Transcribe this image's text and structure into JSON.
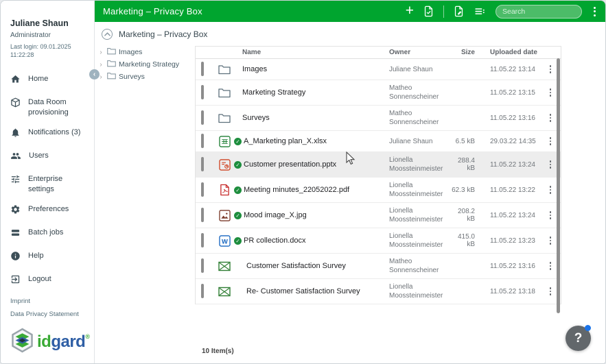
{
  "colors": {
    "brand_green": "#00a52f",
    "logo_green": "#3aaa35",
    "logo_blue": "#2f5fa5",
    "badge_green": "#1e8e3e",
    "row_highlight": "#ededed",
    "help_fab_gray": "#5a5f63",
    "notification_dot_blue": "#1a73e8"
  },
  "sidebar": {
    "user": {
      "name": "Juliane Shaun",
      "role": "Administrator",
      "last_login": "Last login: 09.01.2025 11:22:28"
    },
    "nav": [
      {
        "id": "home",
        "icon": "home-icon",
        "label": "Home"
      },
      {
        "id": "data-room-provisioning",
        "icon": "data-room-icon",
        "label": "Data Room provisioning"
      },
      {
        "id": "notifications",
        "icon": "bell-icon",
        "label": "Notifications (3)"
      },
      {
        "id": "users",
        "icon": "users-icon",
        "label": "Users"
      },
      {
        "id": "enterprise-settings",
        "icon": "sliders-icon",
        "label": "Enterprise settings"
      },
      {
        "id": "preferences",
        "icon": "gear-icon",
        "label": "Preferences"
      },
      {
        "id": "batch-jobs",
        "icon": "batch-icon",
        "label": "Batch jobs"
      },
      {
        "id": "help",
        "icon": "info-icon",
        "label": "Help"
      },
      {
        "id": "logout",
        "icon": "logout-icon",
        "label": "Logout"
      }
    ],
    "links": [
      "Imprint",
      "Data Privacy Statement"
    ],
    "logo": {
      "text_part1": "id",
      "text_part2": "gard",
      "reg_mark": "®"
    }
  },
  "header": {
    "title": "Marketing – Privacy Box",
    "search_placeholder": "Search",
    "action_icons": [
      "add-icon",
      "file-check-icon",
      "file-edit-icon",
      "list-options-icon",
      "more-icon"
    ]
  },
  "breadcrumb": {
    "label": "Marketing – Privacy Box",
    "icon": "chevron-up-circle-icon"
  },
  "tree": {
    "items": [
      {
        "label": "Images",
        "icon": "folder-icon"
      },
      {
        "label": "Marketing Strategy",
        "icon": "folder-icon"
      },
      {
        "label": "Surveys",
        "icon": "folder-icon"
      }
    ]
  },
  "table": {
    "columns": [
      "Name",
      "Owner",
      "Size",
      "Uploaded date"
    ],
    "rows": [
      {
        "type": "folder",
        "name": "Images",
        "owner": "Juliane Shaun",
        "size": "",
        "date": "11.05.22 13:14",
        "verified": false,
        "highlight": false
      },
      {
        "type": "folder",
        "name": "Marketing Strategy",
        "owner": "Matheo Sonnenscheiner",
        "size": "",
        "date": "11.05.22 13:15",
        "verified": false,
        "highlight": false
      },
      {
        "type": "folder",
        "name": "Surveys",
        "owner": "Matheo Sonnenscheiner",
        "size": "",
        "date": "11.05.22 13:16",
        "verified": false,
        "highlight": false
      },
      {
        "type": "xlsx",
        "name": "A_Marketing plan_X.xlsx",
        "owner": "Juliane Shaun",
        "size": "6.5 kB",
        "date": "29.03.22 14:35",
        "verified": true,
        "highlight": false
      },
      {
        "type": "pptx",
        "name": "Customer presentation.pptx",
        "owner": "Lionella Moossteinmeister",
        "size": "288.4 kB",
        "date": "11.05.22 13:24",
        "verified": true,
        "highlight": true
      },
      {
        "type": "pdf",
        "name": "Meeting minutes_22052022.pdf",
        "owner": "Lionella Moossteinmeister",
        "size": "62.3 kB",
        "date": "11.05.22 13:22",
        "verified": true,
        "highlight": false
      },
      {
        "type": "jpg",
        "name": "Mood image_X.jpg",
        "owner": "Lionella Moossteinmeister",
        "size": "208.2 kB",
        "date": "11.05.22 13:24",
        "verified": true,
        "highlight": false
      },
      {
        "type": "docx",
        "name": "PR collection.docx",
        "owner": "Lionella Moossteinmeister",
        "size": "415.0 kB",
        "date": "11.05.22 13:23",
        "verified": true,
        "highlight": false
      },
      {
        "type": "survey",
        "name": "Customer Satisfaction Survey",
        "owner": "Matheo Sonnenscheiner",
        "size": "",
        "date": "11.05.22 13:16",
        "verified": false,
        "highlight": false
      },
      {
        "type": "survey",
        "name": "Re- Customer Satisfaction Survey",
        "owner": "Lionella Moossteinmeister",
        "size": "",
        "date": "11.05.22 13:18",
        "verified": false,
        "highlight": false
      }
    ],
    "footer": "10 Item(s)"
  },
  "help_button": {
    "label": "?"
  }
}
